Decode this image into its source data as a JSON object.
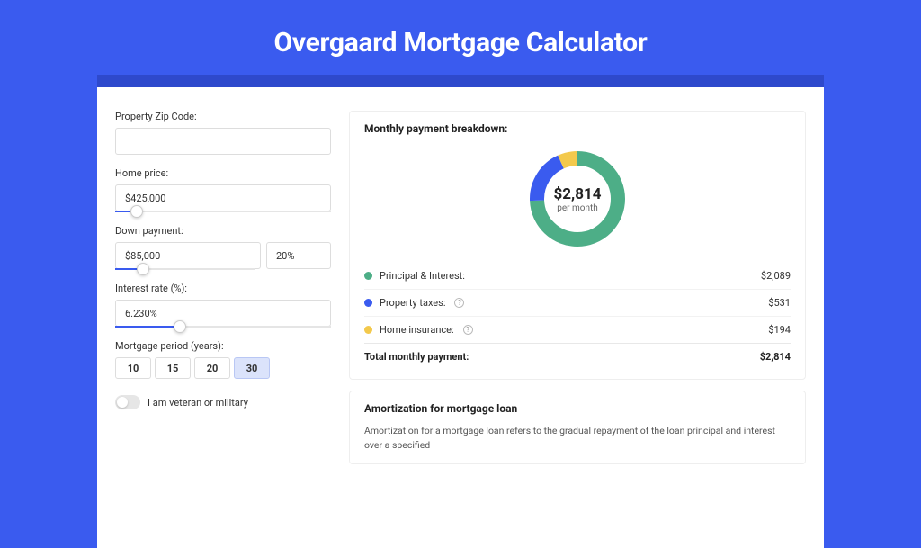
{
  "header": {
    "title": "Overgaard Mortgage Calculator"
  },
  "form": {
    "zip_label": "Property Zip Code:",
    "zip_value": "",
    "home_price_label": "Home price:",
    "home_price_value": "$425,000",
    "home_price_slider_pct": 10,
    "down_payment_label": "Down payment:",
    "down_payment_value": "$85,000",
    "down_payment_pct": "20%",
    "down_payment_slider_pct": 20,
    "rate_label": "Interest rate (%):",
    "rate_value": "6.230%",
    "rate_slider_pct": 30,
    "period_label": "Mortgage period (years):",
    "periods": [
      "10",
      "15",
      "20",
      "30"
    ],
    "period_selected": "30",
    "veteran_label": "I am veteran or military"
  },
  "breakdown": {
    "title": "Monthly payment breakdown:",
    "center_amount": "$2,814",
    "center_sub": "per month",
    "items": [
      {
        "label": "Principal & Interest:",
        "value": "$2,089",
        "color": "g",
        "info": false
      },
      {
        "label": "Property taxes:",
        "value": "$531",
        "color": "b",
        "info": true
      },
      {
        "label": "Home insurance:",
        "value": "$194",
        "color": "y",
        "info": true
      }
    ],
    "total_label": "Total monthly payment:",
    "total_value": "$2,814"
  },
  "chart_data": {
    "type": "pie",
    "title": "Monthly payment breakdown",
    "series": [
      {
        "name": "Principal & Interest",
        "value": 2089,
        "color": "#4DAE87"
      },
      {
        "name": "Property taxes",
        "value": 531,
        "color": "#3A5BEF"
      },
      {
        "name": "Home insurance",
        "value": 194,
        "color": "#F3C94C"
      }
    ],
    "total": 2814,
    "unit": "USD/month"
  },
  "amort": {
    "title": "Amortization for mortgage loan",
    "body": "Amortization for a mortgage loan refers to the gradual repayment of the loan principal and interest over a specified"
  }
}
